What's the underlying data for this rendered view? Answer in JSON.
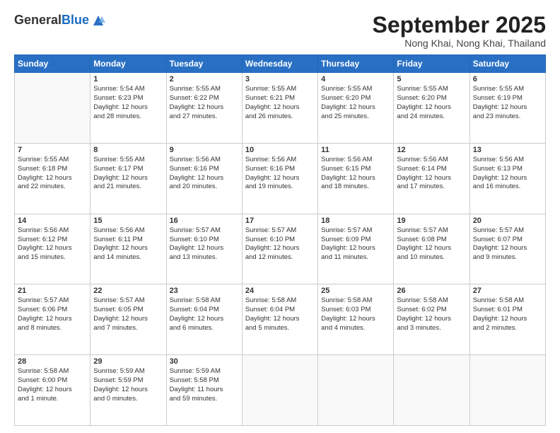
{
  "header": {
    "logo_general": "General",
    "logo_blue": "Blue",
    "month_title": "September 2025",
    "location": "Nong Khai, Nong Khai, Thailand"
  },
  "weekdays": [
    "Sunday",
    "Monday",
    "Tuesday",
    "Wednesday",
    "Thursday",
    "Friday",
    "Saturday"
  ],
  "weeks": [
    [
      {
        "day": "",
        "info": ""
      },
      {
        "day": "1",
        "info": "Sunrise: 5:54 AM\nSunset: 6:23 PM\nDaylight: 12 hours\nand 28 minutes."
      },
      {
        "day": "2",
        "info": "Sunrise: 5:55 AM\nSunset: 6:22 PM\nDaylight: 12 hours\nand 27 minutes."
      },
      {
        "day": "3",
        "info": "Sunrise: 5:55 AM\nSunset: 6:21 PM\nDaylight: 12 hours\nand 26 minutes."
      },
      {
        "day": "4",
        "info": "Sunrise: 5:55 AM\nSunset: 6:20 PM\nDaylight: 12 hours\nand 25 minutes."
      },
      {
        "day": "5",
        "info": "Sunrise: 5:55 AM\nSunset: 6:20 PM\nDaylight: 12 hours\nand 24 minutes."
      },
      {
        "day": "6",
        "info": "Sunrise: 5:55 AM\nSunset: 6:19 PM\nDaylight: 12 hours\nand 23 minutes."
      }
    ],
    [
      {
        "day": "7",
        "info": "Sunrise: 5:55 AM\nSunset: 6:18 PM\nDaylight: 12 hours\nand 22 minutes."
      },
      {
        "day": "8",
        "info": "Sunrise: 5:55 AM\nSunset: 6:17 PM\nDaylight: 12 hours\nand 21 minutes."
      },
      {
        "day": "9",
        "info": "Sunrise: 5:56 AM\nSunset: 6:16 PM\nDaylight: 12 hours\nand 20 minutes."
      },
      {
        "day": "10",
        "info": "Sunrise: 5:56 AM\nSunset: 6:16 PM\nDaylight: 12 hours\nand 19 minutes."
      },
      {
        "day": "11",
        "info": "Sunrise: 5:56 AM\nSunset: 6:15 PM\nDaylight: 12 hours\nand 18 minutes."
      },
      {
        "day": "12",
        "info": "Sunrise: 5:56 AM\nSunset: 6:14 PM\nDaylight: 12 hours\nand 17 minutes."
      },
      {
        "day": "13",
        "info": "Sunrise: 5:56 AM\nSunset: 6:13 PM\nDaylight: 12 hours\nand 16 minutes."
      }
    ],
    [
      {
        "day": "14",
        "info": "Sunrise: 5:56 AM\nSunset: 6:12 PM\nDaylight: 12 hours\nand 15 minutes."
      },
      {
        "day": "15",
        "info": "Sunrise: 5:56 AM\nSunset: 6:11 PM\nDaylight: 12 hours\nand 14 minutes."
      },
      {
        "day": "16",
        "info": "Sunrise: 5:57 AM\nSunset: 6:10 PM\nDaylight: 12 hours\nand 13 minutes."
      },
      {
        "day": "17",
        "info": "Sunrise: 5:57 AM\nSunset: 6:10 PM\nDaylight: 12 hours\nand 12 minutes."
      },
      {
        "day": "18",
        "info": "Sunrise: 5:57 AM\nSunset: 6:09 PM\nDaylight: 12 hours\nand 11 minutes."
      },
      {
        "day": "19",
        "info": "Sunrise: 5:57 AM\nSunset: 6:08 PM\nDaylight: 12 hours\nand 10 minutes."
      },
      {
        "day": "20",
        "info": "Sunrise: 5:57 AM\nSunset: 6:07 PM\nDaylight: 12 hours\nand 9 minutes."
      }
    ],
    [
      {
        "day": "21",
        "info": "Sunrise: 5:57 AM\nSunset: 6:06 PM\nDaylight: 12 hours\nand 8 minutes."
      },
      {
        "day": "22",
        "info": "Sunrise: 5:57 AM\nSunset: 6:05 PM\nDaylight: 12 hours\nand 7 minutes."
      },
      {
        "day": "23",
        "info": "Sunrise: 5:58 AM\nSunset: 6:04 PM\nDaylight: 12 hours\nand 6 minutes."
      },
      {
        "day": "24",
        "info": "Sunrise: 5:58 AM\nSunset: 6:04 PM\nDaylight: 12 hours\nand 5 minutes."
      },
      {
        "day": "25",
        "info": "Sunrise: 5:58 AM\nSunset: 6:03 PM\nDaylight: 12 hours\nand 4 minutes."
      },
      {
        "day": "26",
        "info": "Sunrise: 5:58 AM\nSunset: 6:02 PM\nDaylight: 12 hours\nand 3 minutes."
      },
      {
        "day": "27",
        "info": "Sunrise: 5:58 AM\nSunset: 6:01 PM\nDaylight: 12 hours\nand 2 minutes."
      }
    ],
    [
      {
        "day": "28",
        "info": "Sunrise: 5:58 AM\nSunset: 6:00 PM\nDaylight: 12 hours\nand 1 minute."
      },
      {
        "day": "29",
        "info": "Sunrise: 5:59 AM\nSunset: 5:59 PM\nDaylight: 12 hours\nand 0 minutes."
      },
      {
        "day": "30",
        "info": "Sunrise: 5:59 AM\nSunset: 5:58 PM\nDaylight: 11 hours\nand 59 minutes."
      },
      {
        "day": "",
        "info": ""
      },
      {
        "day": "",
        "info": ""
      },
      {
        "day": "",
        "info": ""
      },
      {
        "day": "",
        "info": ""
      }
    ]
  ]
}
